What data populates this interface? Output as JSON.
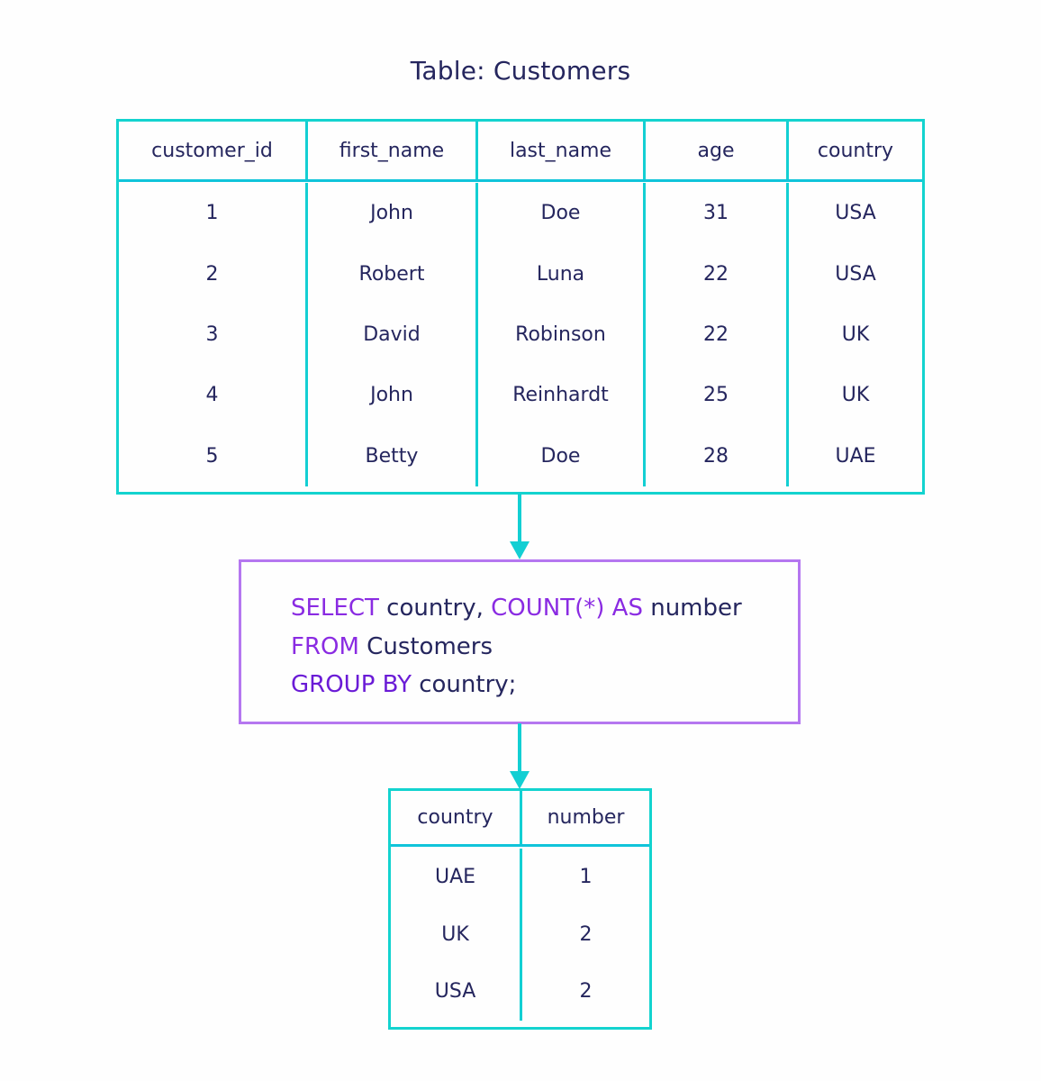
{
  "title": "Table: Customers",
  "customers_table": {
    "columns": [
      "customer_id",
      "first_name",
      "last_name",
      "age",
      "country"
    ],
    "rows": [
      [
        "1",
        "John",
        "Doe",
        "31",
        "USA"
      ],
      [
        "2",
        "Robert",
        "Luna",
        "22",
        "USA"
      ],
      [
        "3",
        "David",
        "Robinson",
        "22",
        "UK"
      ],
      [
        "4",
        "John",
        "Reinhardt",
        "25",
        "UK"
      ],
      [
        "5",
        "Betty",
        "Doe",
        "28",
        "UAE"
      ]
    ]
  },
  "query": {
    "lines": [
      [
        {
          "t": "SELECT",
          "k": "kw"
        },
        {
          "t": " country, ",
          "k": "plain"
        },
        {
          "t": "COUNT(*) AS",
          "k": "kw"
        },
        {
          "t": " number",
          "k": "plain"
        }
      ],
      [
        {
          "t": "FROM",
          "k": "kw"
        },
        {
          "t": " Customers",
          "k": "plain"
        }
      ],
      [
        {
          "t": "GROUP BY",
          "k": "kw2"
        },
        {
          "t": " country;",
          "k": "plain"
        }
      ]
    ]
  },
  "result_table": {
    "columns": [
      "country",
      "number"
    ],
    "rows": [
      [
        "UAE",
        "1"
      ],
      [
        "UK",
        "2"
      ],
      [
        "USA",
        "2"
      ]
    ]
  },
  "colors": {
    "table_border": "#13d3cf",
    "query_border": "#b577f0",
    "keyword": "#8a2be2",
    "text": "#25265e",
    "arrow": "#13cfd3"
  }
}
